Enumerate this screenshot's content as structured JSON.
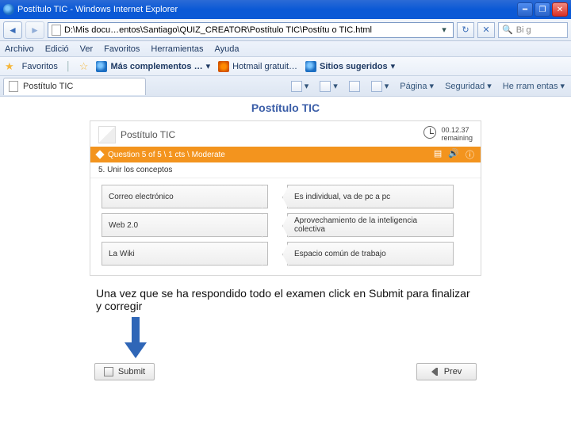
{
  "window": {
    "title": "Postítulo TIC - Windows Internet Explorer"
  },
  "address": {
    "value": "D:\\Mis docu…entos\\Santiago\\QUIZ_CREATOR\\Postítulo TIC\\Postítu o TIC.html"
  },
  "search": {
    "placeholder": "Bi g"
  },
  "menu": {
    "archivo": "Archivo",
    "edicion": "Edició",
    "ver": "Ver",
    "favoritos": "Favoritos",
    "herramientas": "Herramientas",
    "ayuda": "Ayuda"
  },
  "favbar": {
    "favoritos": "Favoritos",
    "mas": "Más complementos …",
    "hotmail": "Hotmail gratuit…",
    "sitios": "Sitios sugeridos"
  },
  "tab": {
    "label": "Postítulo TIC"
  },
  "toolbar": {
    "pagina": "Página",
    "seguridad": "Seguridad",
    "herramientas": "He rram entas"
  },
  "page": {
    "title": "Postítulo TIC"
  },
  "quiz": {
    "header": "Postítulo TIC",
    "timer_value": "00.12.37",
    "timer_label": "remaining",
    "progress": "Question 5 of 5 \\ 1 cts \\ Moderate",
    "subtitle": "5. Unir los conceptos",
    "pairs": [
      {
        "left": "Correo electrónico",
        "right": "Es individual, va de pc a pc"
      },
      {
        "left": "Web 2.0",
        "right": "Aprovechamiento de la inteligencia colectiva"
      },
      {
        "left": "La Wiki",
        "right": "Espacio común de trabajo"
      }
    ]
  },
  "instruction": "Una vez que se ha respondido todo el examen click en Submit para finalizar y corregir",
  "footer": {
    "submit": "Submit",
    "prev": "Prev"
  }
}
